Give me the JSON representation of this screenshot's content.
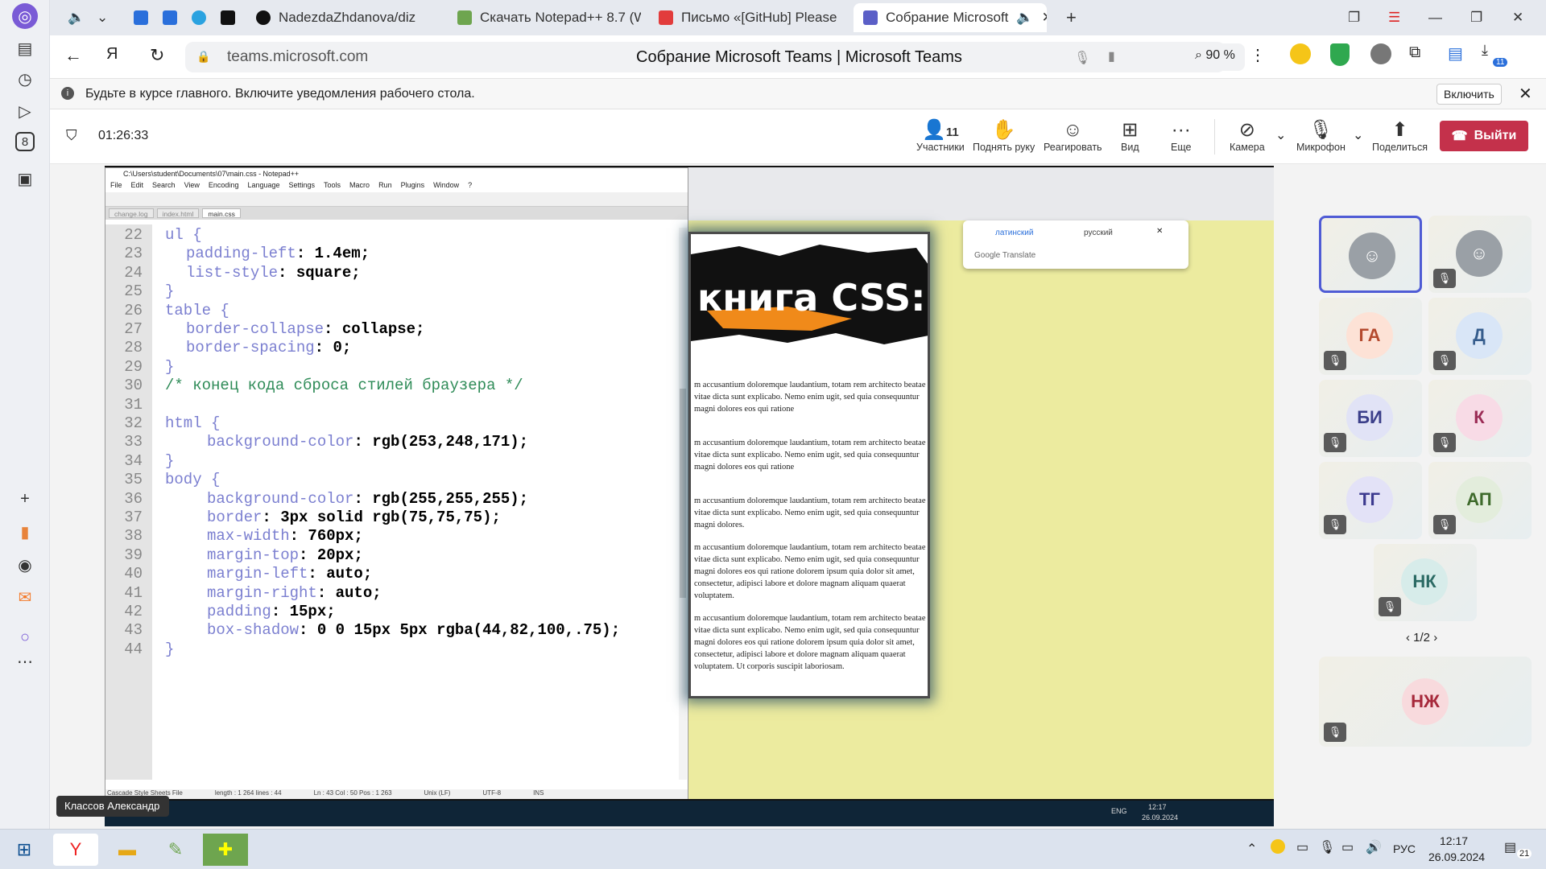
{
  "browser": {
    "tabs": [
      {
        "label": "NadezdaZhdanova/diz",
        "icon": "github-icon"
      },
      {
        "label": "Скачать Notepad++ 8.7 (W",
        "icon": "notepad-icon"
      },
      {
        "label": "Письмо «[GitHub] Please",
        "icon": "mail-icon"
      },
      {
        "label": "Собрание Microsoft",
        "icon": "teams-icon"
      }
    ],
    "url": "teams.microsoft.com",
    "page_title": "Собрание Microsoft Teams | Microsoft Teams",
    "zoom": "90 %",
    "ext_badge": "11",
    "notif_text": "Будьте в курсе главного. Включите уведомления рабочего стола.",
    "notif_button": "Включить"
  },
  "meeting": {
    "timer": "01:26:33",
    "participants_count": "11",
    "buttons": {
      "participants": "Участники",
      "raise_hand": "Поднять руку",
      "react": "Реагировать",
      "view": "Вид",
      "more": "Еще",
      "camera": "Камера",
      "mic": "Микрофон",
      "share": "Поделиться",
      "leave": "Выйти"
    },
    "pager": "1/2",
    "presenter_name": "Классов Александр",
    "tiles": [
      {
        "initials": "",
        "bg": "#9aa0a6",
        "fg": "#fff",
        "muted": false,
        "selected": true
      },
      {
        "initials": "",
        "bg": "#9aa0a6",
        "fg": "#fff",
        "muted": true
      },
      {
        "initials": "ГА",
        "bg": "#fde2d6",
        "fg": "#b44a2e",
        "muted": true
      },
      {
        "initials": "Д",
        "bg": "#d9e6f7",
        "fg": "#355c8c",
        "muted": true
      },
      {
        "initials": "БИ",
        "bg": "#e1e3f6",
        "fg": "#3b3f8a",
        "muted": true
      },
      {
        "initials": "К",
        "bg": "#f8dbe6",
        "fg": "#9b2c55",
        "muted": true
      },
      {
        "initials": "ТГ",
        "bg": "#e3e2f7",
        "fg": "#3c3a8f",
        "muted": true
      },
      {
        "initials": "АП",
        "bg": "#e3eddc",
        "fg": "#3e6a2b",
        "muted": true
      },
      {
        "initials": "НК",
        "bg": "#d7ecea",
        "fg": "#2b6a64",
        "muted": true
      },
      {
        "initials": "НЖ",
        "bg": "#f8dadd",
        "fg": "#a6283a",
        "muted": true
      }
    ]
  },
  "notepad": {
    "title": "C:\\Users\\student\\Documents\\07\\main.css - Notepad++",
    "menu": [
      "File",
      "Edit",
      "Search",
      "View",
      "Encoding",
      "Language",
      "Settings",
      "Tools",
      "Macro",
      "Run",
      "Plugins",
      "Window",
      "?"
    ],
    "tabs": [
      "change.log",
      "index.html",
      "main.css"
    ],
    "lines": [
      {
        "n": "22",
        "t": "ul {",
        "c": "br",
        "i": 0
      },
      {
        "n": "23",
        "t": "padding-left: 1.4em;",
        "c": "kw",
        "i": 1
      },
      {
        "n": "24",
        "t": "list-style: square;",
        "c": "kw",
        "i": 1
      },
      {
        "n": "25",
        "t": "}",
        "c": "br",
        "i": 0
      },
      {
        "n": "26",
        "t": "table {",
        "c": "br",
        "i": 0
      },
      {
        "n": "27",
        "t": "border-collapse: collapse;",
        "c": "kw",
        "i": 1
      },
      {
        "n": "28",
        "t": "border-spacing: 0;",
        "c": "kw",
        "i": 1
      },
      {
        "n": "29",
        "t": "}",
        "c": "br",
        "i": 0
      },
      {
        "n": "30",
        "t": "/* конец кода сброса стилей браузера */",
        "c": "cm",
        "i": 0
      },
      {
        "n": "31",
        "t": "",
        "c": "br",
        "i": 0
      },
      {
        "n": "32",
        "t": "html {",
        "c": "br",
        "i": 0
      },
      {
        "n": "33",
        "t": "background-color: rgb(253,248,171);",
        "c": "kw",
        "i": 2
      },
      {
        "n": "34",
        "t": "}",
        "c": "br",
        "i": 0
      },
      {
        "n": "35",
        "t": "body {",
        "c": "br",
        "i": 0
      },
      {
        "n": "36",
        "t": "background-color: rgb(255,255,255);",
        "c": "kw",
        "i": 2
      },
      {
        "n": "37",
        "t": "border: 3px solid rgb(75,75,75);",
        "c": "kw",
        "i": 2
      },
      {
        "n": "38",
        "t": "max-width: 760px;",
        "c": "kw",
        "i": 2
      },
      {
        "n": "39",
        "t": "margin-top: 20px;",
        "c": "kw",
        "i": 2
      },
      {
        "n": "40",
        "t": "margin-left: auto;",
        "c": "kw",
        "i": 2
      },
      {
        "n": "41",
        "t": "margin-right: auto;",
        "c": "kw",
        "i": 2
      },
      {
        "n": "42",
        "t": "padding: 15px;",
        "c": "kw",
        "i": 2
      },
      {
        "n": "43",
        "t": "box-shadow: 0 0 15px 5px rgba(44,82,100,.75);",
        "c": "kw",
        "i": 2
      },
      {
        "n": "44",
        "t": "}",
        "c": "br",
        "i": 0
      }
    ],
    "status": [
      "Cascade Style Sheets File",
      "length : 1 264    lines : 44",
      "Ln : 43    Col : 50    Pos : 1 263",
      "Unix (LF)",
      "UTF-8",
      "INS"
    ]
  },
  "shared_browser": {
    "translate_tabs": [
      "латинский",
      "русский"
    ],
    "translate_brand": "Google Translate",
    "banner_text": "книга CSS:",
    "paragraphs": [
      "m accusantium doloremque laudantium, totam rem architecto beatae vitae dicta sunt explicabo. Nemo enim ugit, sed quia consequuntur magni dolores eos qui ratione",
      "m accusantium doloremque laudantium, totam rem architecto beatae vitae dicta sunt explicabo. Nemo enim ugit, sed quia consequuntur magni dolores eos qui ratione",
      "m accusantium doloremque laudantium, totam rem architecto beatae vitae dicta sunt explicabo. Nemo enim ugit, sed quia consequuntur magni dolores.",
      "m accusantium doloremque laudantium, totam rem architecto beatae vitae dicta sunt explicabo. Nemo enim ugit, sed quia consequuntur magni dolores eos qui ratione dolorem ipsum quia dolor sit amet, consectetur, adipisci labore et dolore magnam aliquam quaerat voluptatem.",
      "m accusantium doloremque laudantium, totam rem architecto beatae vitae dicta sunt explicabo. Nemo enim ugit, sed quia consequuntur magni dolores eos qui ratione dolorem ipsum quia dolor sit amet, consectetur, adipisci labore et dolore magnam aliquam quaerat voluptatem. Ut corporis suscipit laboriosam."
    ],
    "remote_clock_time": "12:17",
    "remote_clock_date": "26.09.2024",
    "remote_lang": "ENG"
  },
  "taskbar": {
    "lang": "РУС",
    "time": "12:17",
    "date": "26.09.2024",
    "notif_count": "21"
  }
}
